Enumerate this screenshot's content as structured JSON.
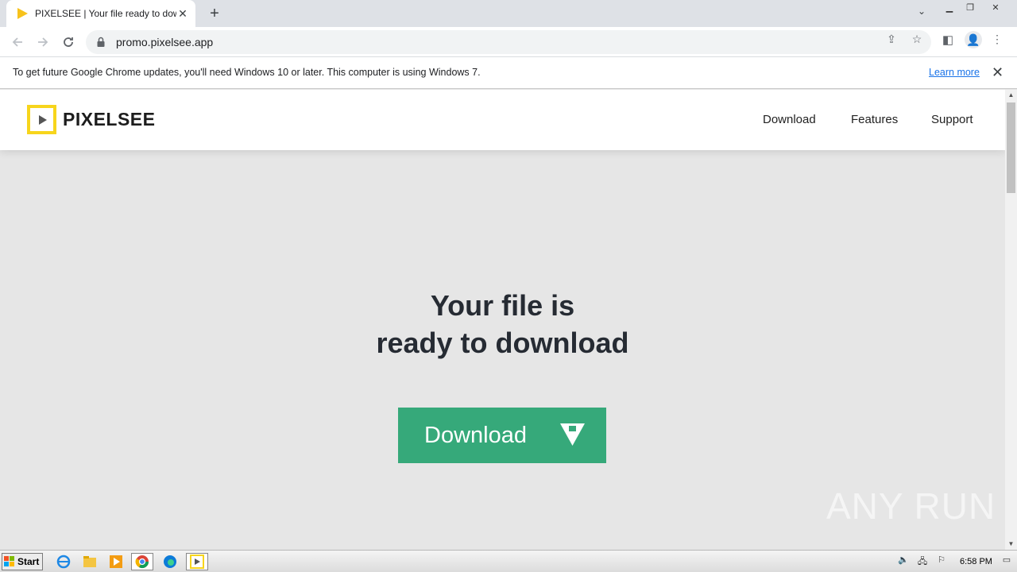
{
  "browser": {
    "tab_title": "PIXELSEE | Your file ready to downlo",
    "url": "promo.pixelsee.app"
  },
  "infobar": {
    "message": "To get future Google Chrome updates, you'll need Windows 10 or later. This computer is using Windows 7.",
    "learn_more": "Learn more"
  },
  "site": {
    "brand": "PIXELSEE",
    "nav": [
      "Download",
      "Features",
      "Support"
    ],
    "headline_line1": "Your file is",
    "headline_line2": "ready to download",
    "download_button": "Download",
    "accent_color": "#36a97a",
    "logo_color": "#f7d51c"
  },
  "watermark": "ANY RUN",
  "taskbar": {
    "start_label": "Start",
    "clock": "6:58 PM"
  }
}
